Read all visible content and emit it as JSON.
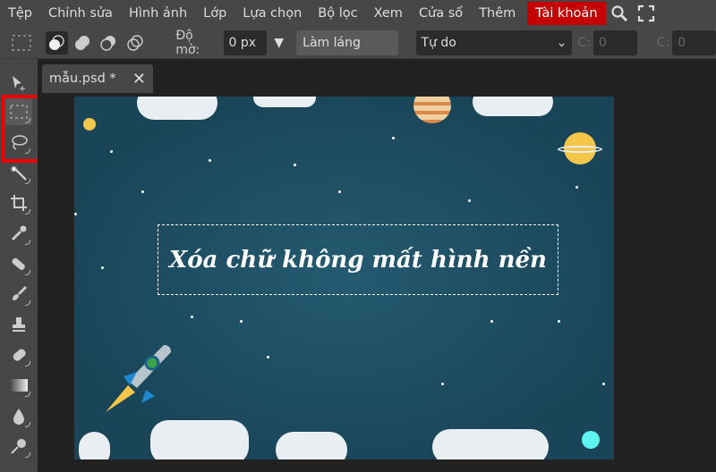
{
  "menu": {
    "items": [
      "Tệp",
      "Chỉnh sửa",
      "Hình ảnh",
      "Lớp",
      "Lựa chọn",
      "Bộ lọc",
      "Xem",
      "Cửa sổ",
      "Thêm"
    ],
    "account": "Tài khoản",
    "account_color": "#c50000"
  },
  "options": {
    "feather_label": "Độ mờ:",
    "feather_value": "0 px",
    "refine_edge": "Làm láng cạnh",
    "style_value": "Tự do",
    "w_label": "C:",
    "w_value": "0",
    "h_label": "C:",
    "h_value": "0"
  },
  "document": {
    "tab_title": "mẫu.psd *",
    "headline": "Xóa chữ không mất hình nền"
  },
  "tools": [
    "move",
    "rect-marquee",
    "lasso",
    "magic-wand",
    "crop",
    "eyedropper",
    "healing",
    "brush",
    "stamp",
    "eraser",
    "gradient",
    "blur",
    "dodge"
  ]
}
